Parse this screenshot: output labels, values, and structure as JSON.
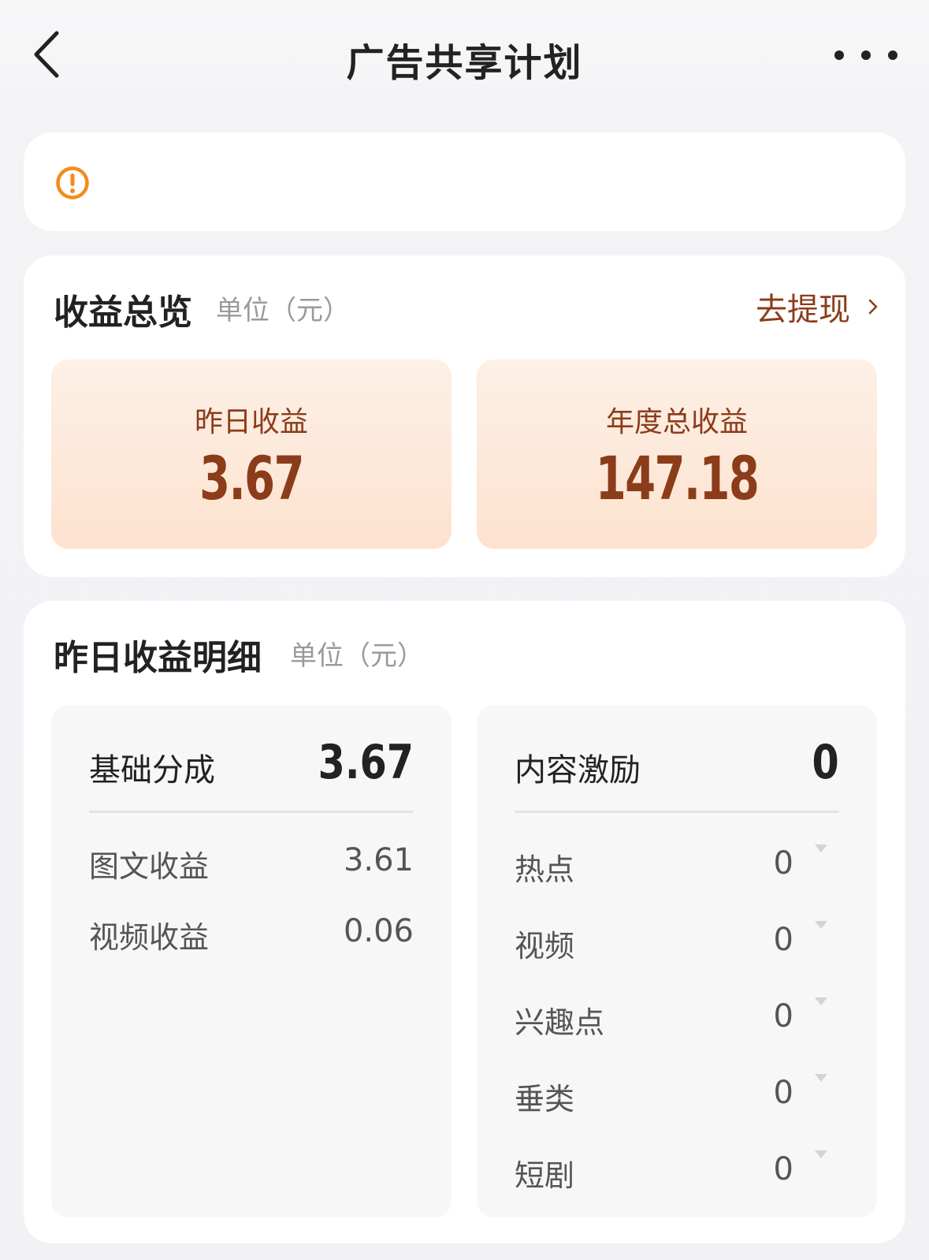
{
  "header": {
    "title": "广告共享计划"
  },
  "notice": {
    "text": ""
  },
  "overview": {
    "title": "收益总览",
    "unit": "单位（元）",
    "withdraw_label": "去提现",
    "yesterday": {
      "label": "昨日收益",
      "value": "3.67"
    },
    "annual": {
      "label": "年度总收益",
      "value": "147.18"
    }
  },
  "detail": {
    "title": "昨日收益明细",
    "unit": "单位（元）",
    "base": {
      "label": "基础分成",
      "value": "3.67",
      "items": [
        {
          "label": "图文收益",
          "value": "3.61"
        },
        {
          "label": "视频收益",
          "value": "0.06"
        }
      ]
    },
    "content": {
      "label": "内容激励",
      "value": "0",
      "items": [
        {
          "label": "热点",
          "value": "0"
        },
        {
          "label": "视频",
          "value": "0"
        },
        {
          "label": "兴趣点",
          "value": "0"
        },
        {
          "label": "垂类",
          "value": "0"
        },
        {
          "label": "短剧",
          "value": "0"
        }
      ]
    }
  },
  "colors": {
    "accent_brown": "#8b3c1a",
    "warning_orange": "#f28c1c",
    "card_peach": "#fde2cf"
  }
}
